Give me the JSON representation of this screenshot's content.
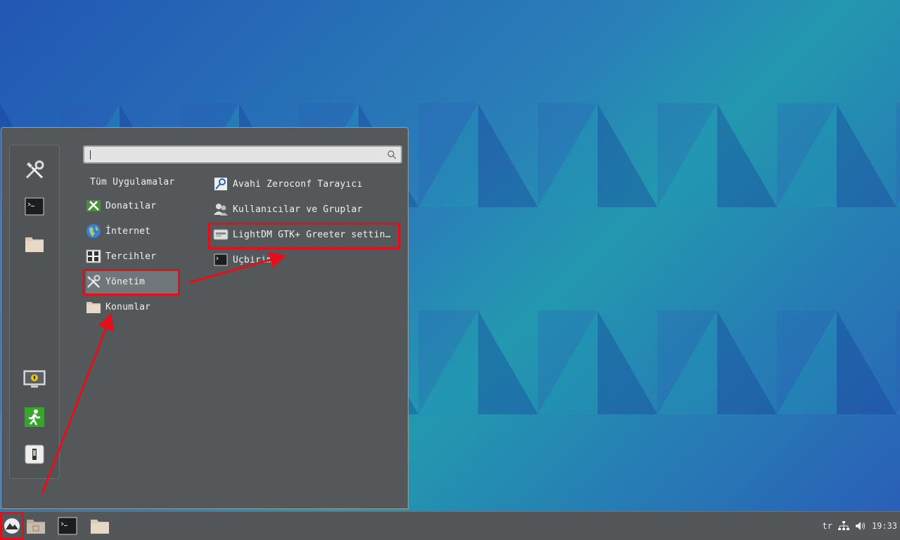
{
  "menu": {
    "search": {
      "value": "",
      "placeholder": ""
    },
    "all_apps_label": "Tüm Uygulamalar",
    "categories": [
      {
        "label": "Donatılar",
        "icon": "accessories-icon"
      },
      {
        "label": "İnternet",
        "icon": "internet-globe-icon"
      },
      {
        "label": "Tercihler",
        "icon": "preferences-icon"
      },
      {
        "label": "Yönetim",
        "icon": "administration-tools-icon"
      },
      {
        "label": "Konumlar",
        "icon": "places-folder-icon"
      }
    ],
    "apps": [
      {
        "label": "Avahi Zeroconf Tarayıcı",
        "icon": "avahi-browser-icon"
      },
      {
        "label": "Kullanıcılar ve Gruplar",
        "icon": "users-groups-icon"
      },
      {
        "label": "LightDM GTK+ Greeter settin…",
        "icon": "lightdm-settings-icon"
      },
      {
        "label": "Uçbirim",
        "icon": "terminal-icon"
      }
    ],
    "selected_category": "Yönetim"
  },
  "taskbar": {
    "tray": {
      "keyboard_layout": "tr",
      "clock": "19:33"
    }
  },
  "colors": {
    "highlight": "#e3101b",
    "menu_bg": "#54585a",
    "taskbar_bg": "#53575a"
  }
}
